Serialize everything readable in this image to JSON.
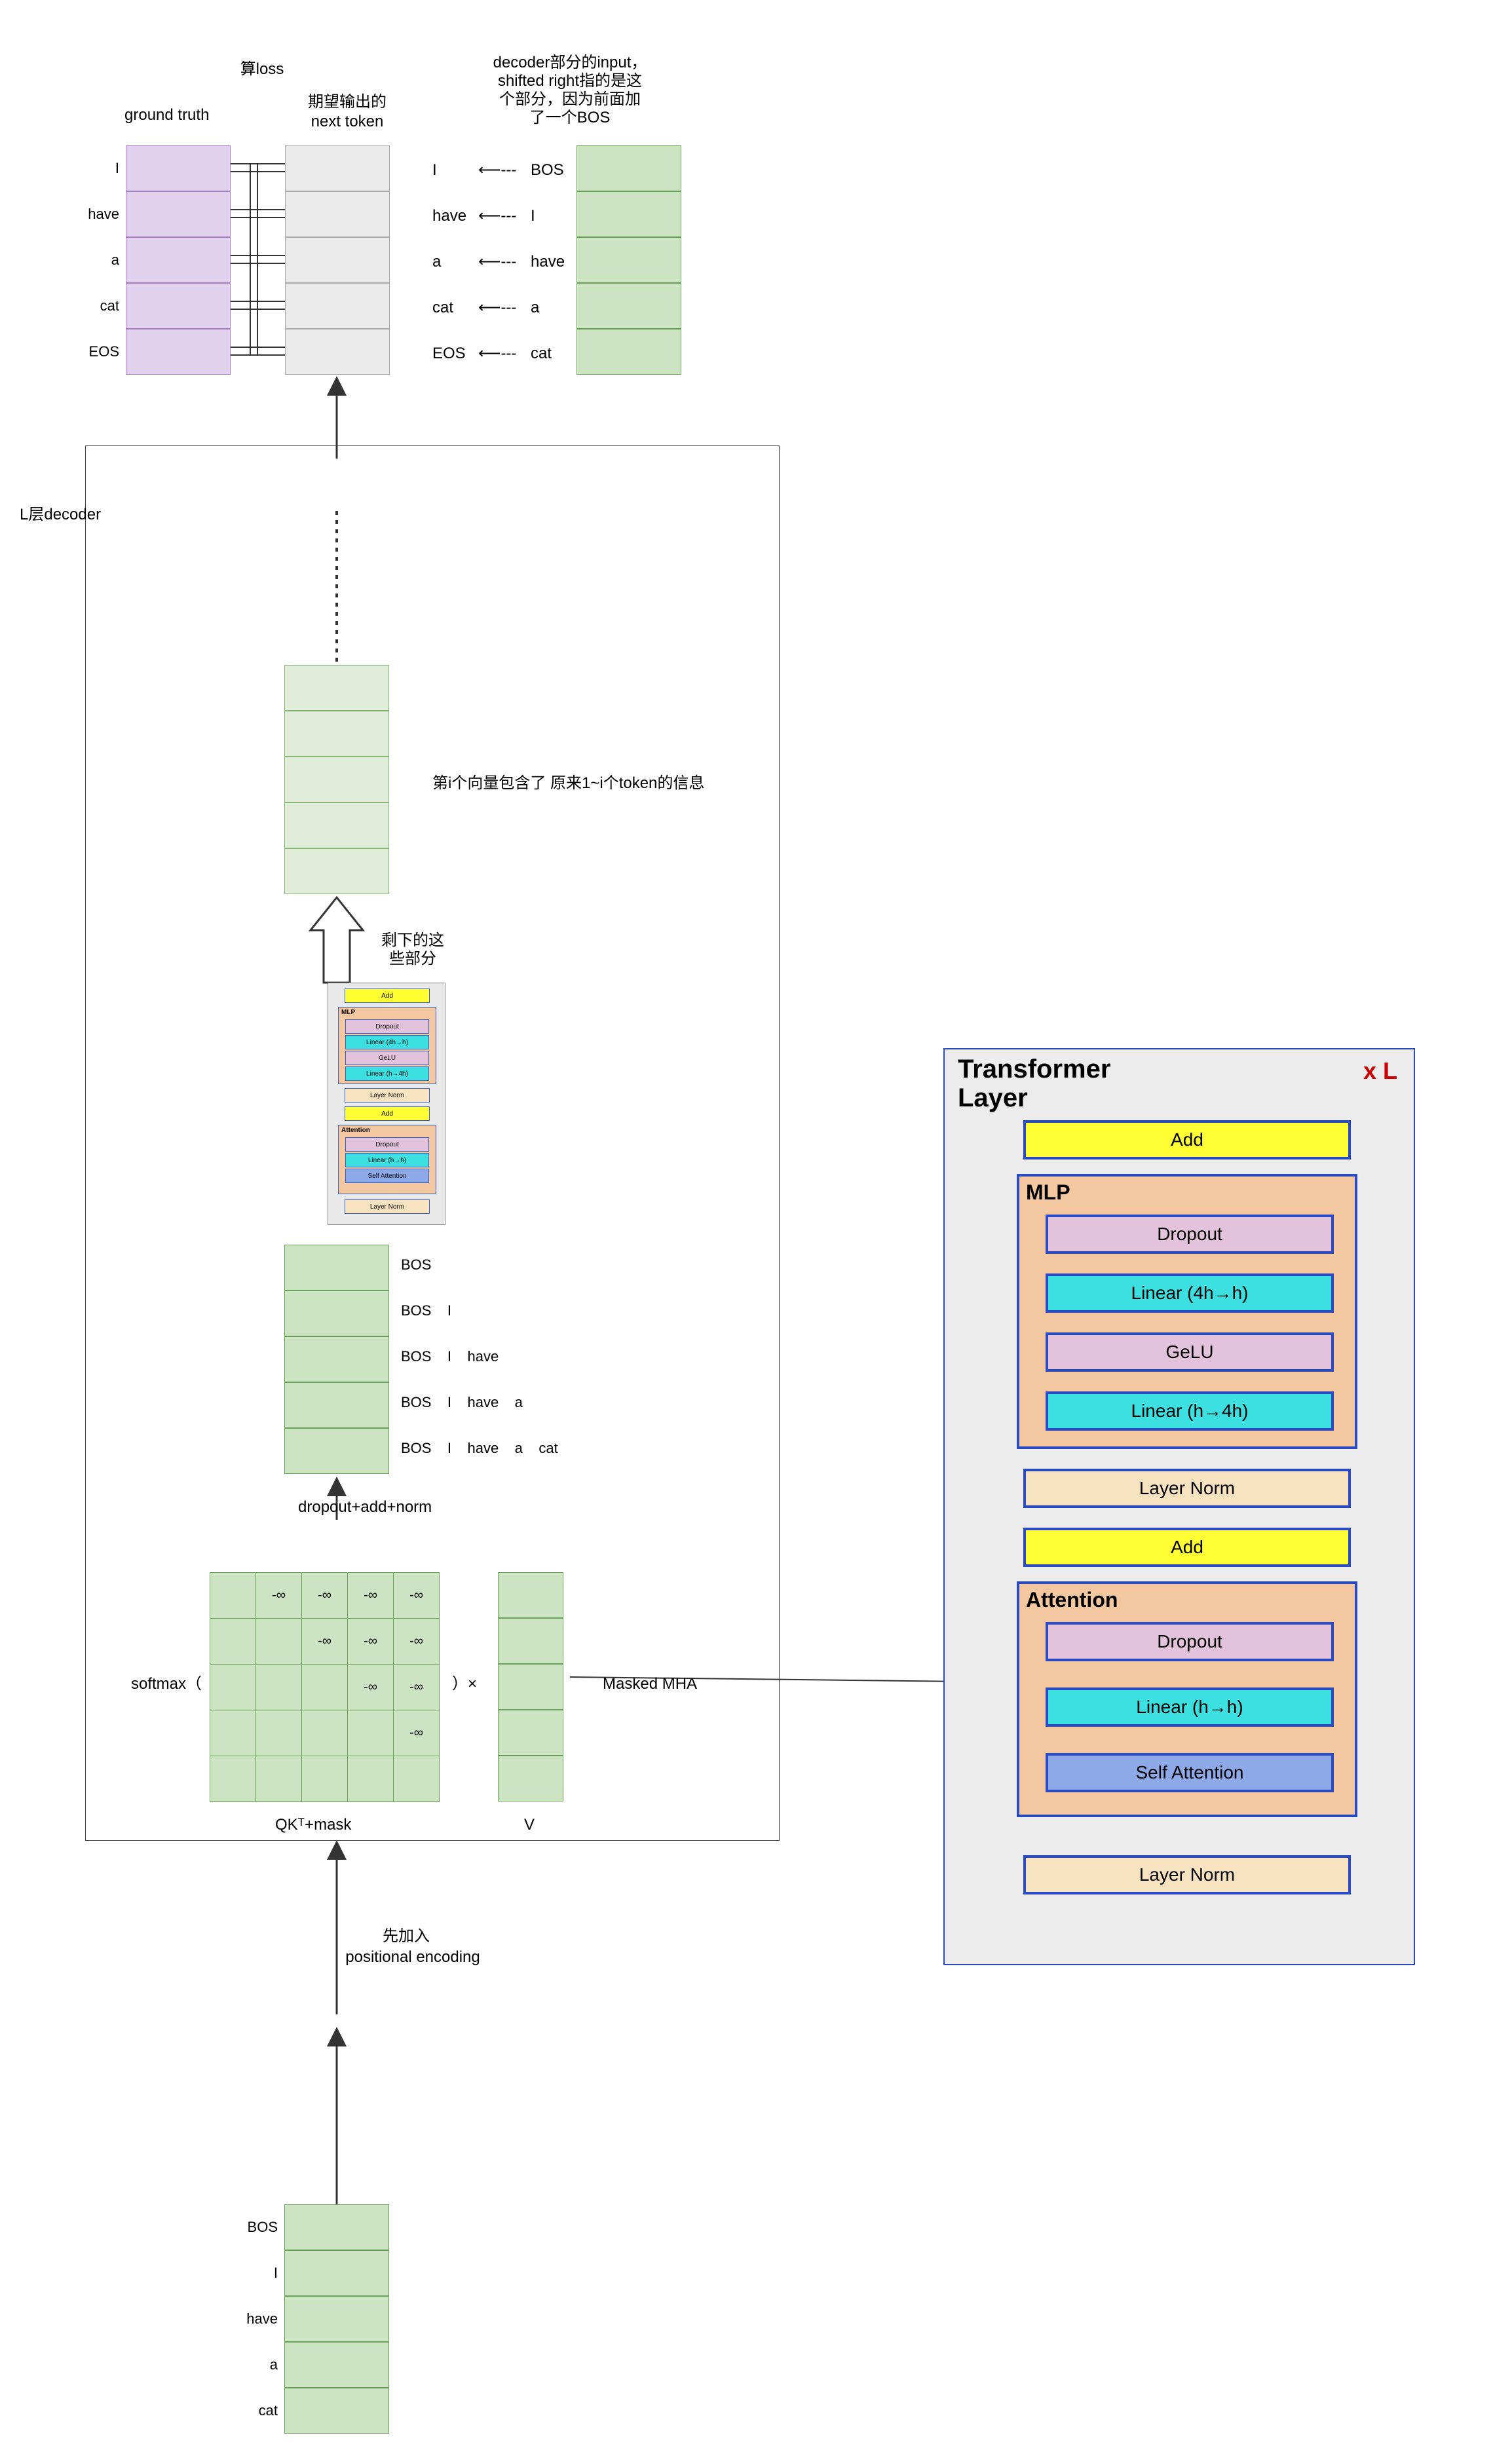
{
  "labels": {
    "loss": "算loss",
    "ground_truth": "ground truth",
    "expected": "期望输出的",
    "next_token": "next token",
    "decoder_input_note1": "decoder部分的input，",
    "decoder_input_note2": "shifted right指的是这",
    "decoder_input_note3": "个部分，因为前面加",
    "decoder_input_note4": "了一个BOS",
    "ldecoder": "L层decoder",
    "vec_note": "第i个向量包含了 原来1~i个token的信息",
    "remain1": "剩下的这",
    "remain2": "些部分",
    "dropout_label": "dropout+add+norm",
    "softmax_open": "softmax（",
    "close_times": "）×",
    "masked_mha": "Masked MHA",
    "qktmask": "QKᵀ+mask",
    "vlabel": "V",
    "pe1": "先加入",
    "pe2": "positional encoding"
  },
  "arrows": {
    "a1": "⟵---",
    "a2": "⟵---",
    "a3": "⟵---",
    "a4": "⟵---",
    "a5": "⟵---"
  },
  "top": {
    "gt": [
      "I",
      "have",
      "a",
      "cat",
      "EOS"
    ],
    "exp": [
      "",
      "",
      "",
      "",
      ""
    ],
    "out": [
      "I",
      "have",
      "a",
      "cat",
      "EOS"
    ],
    "shift": [
      "BOS",
      "I",
      "have",
      "a",
      "cat"
    ],
    "blank": [
      "",
      "",
      "",
      "",
      ""
    ]
  },
  "rows": {
    "bos_rows": [
      [
        "BOS"
      ],
      [
        "BOS",
        "I"
      ],
      [
        "BOS",
        "I",
        "have"
      ],
      [
        "BOS",
        "I",
        "have",
        "a"
      ],
      [
        "BOS",
        "I",
        "have",
        "a",
        "cat"
      ]
    ]
  },
  "matrix_mask": [
    [
      "",
      "-∞",
      "-∞",
      "-∞",
      "-∞"
    ],
    [
      "",
      "",
      "-∞",
      "-∞",
      "-∞"
    ],
    [
      "",
      "",
      "",
      "-∞",
      "-∞"
    ],
    [
      "",
      "",
      "",
      "",
      "-∞"
    ],
    [
      "",
      "",
      "",
      "",
      ""
    ]
  ],
  "bottom_tokens": [
    "BOS",
    "I",
    "have",
    "a",
    "cat"
  ],
  "mini": {
    "add1": "Add",
    "mlp": "MLP",
    "drop": "Dropout",
    "lin1": "Linear (4h→h)",
    "gelu": "GeLU",
    "lin2": "Linear (h→4h)",
    "ln1": "Layer Norm",
    "add2": "Add",
    "attn": "Attention",
    "drop2": "Dropout",
    "lin3": "Linear (h→h)",
    "sa": "Self Attention",
    "ln2": "Layer Norm"
  },
  "tf": {
    "title": "Transformer",
    "title2": "Layer",
    "xl": "x L",
    "add": "Add",
    "mlp": "MLP",
    "dropout": "Dropout",
    "lin4h_h": "Linear (4h→h)",
    "gelu": "GeLU",
    "linh_4h": "Linear (h→4h)",
    "ln": "Layer Norm",
    "attention": "Attention",
    "lin_hh": "Linear (h→h)",
    "self_attn": "Self Attention"
  }
}
